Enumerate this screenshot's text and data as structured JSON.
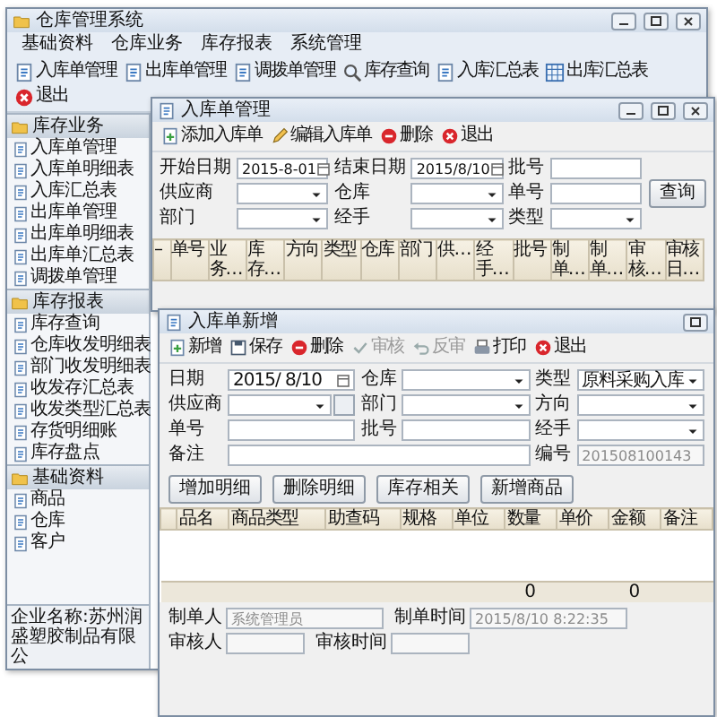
{
  "main_window": {
    "title": "仓库管理系统",
    "menu": [
      "基础资料",
      "仓库业务",
      "库存报表",
      "系统管理"
    ],
    "toolbar": [
      {
        "label": "入库单管理",
        "kind": "document"
      },
      {
        "label": "出库单管理",
        "kind": "document"
      },
      {
        "label": "调拨单管理",
        "kind": "document"
      },
      {
        "label": "库存查询",
        "kind": "search"
      },
      {
        "label": "入库汇总表",
        "kind": "document"
      },
      {
        "label": "出库汇总表",
        "kind": "table"
      },
      {
        "label": "退出",
        "kind": "exit"
      }
    ],
    "sidebar": [
      {
        "title": "库存业务",
        "items": [
          "入库单管理",
          "入库单明细表",
          "入库汇总表",
          "出库单管理",
          "出库单明细表",
          "出库单汇总表",
          "调拨单管理"
        ]
      },
      {
        "title": "库存报表",
        "items": [
          "库存查询",
          "仓库收发明细表",
          "部门收发明细表",
          "收发存汇总表",
          "收发类型汇总表",
          "存货明细账",
          "库存盘点"
        ]
      },
      {
        "title": "基础资料",
        "items": [
          "商品",
          "仓库",
          "客户"
        ]
      }
    ],
    "status_bar": "企业名称:苏州润盛塑胶制品有限公"
  },
  "query_window": {
    "title": "入库单管理",
    "toolbar": [
      {
        "label": "添加入库单",
        "kind": "add"
      },
      {
        "label": "编辑入库单",
        "kind": "edit"
      },
      {
        "label": "删除",
        "kind": "delete"
      },
      {
        "label": "退出",
        "kind": "exit"
      }
    ],
    "fields": [
      {
        "label": "开始日期",
        "kind": "date",
        "value": "2015-8-01"
      },
      {
        "label": "结束日期",
        "kind": "date",
        "value": "2015/8/10"
      },
      {
        "label": "批号",
        "kind": "text"
      },
      {
        "label": "供应商",
        "kind": "select"
      },
      {
        "label": "仓库",
        "kind": "select"
      },
      {
        "label": "单号",
        "kind": "text"
      },
      {
        "label": "部门",
        "kind": "select"
      },
      {
        "label": "经手",
        "kind": "select"
      },
      {
        "label": "类型",
        "kind": "select"
      }
    ],
    "search_button": "查询",
    "columns": [
      "–",
      "单号",
      "业务…",
      "库存…",
      "方向",
      "类型",
      "仓库",
      "部门",
      "供…",
      "经手…",
      "批号",
      "制单…",
      "制单…",
      "审核…",
      "审核日…"
    ]
  },
  "entry_window": {
    "title": "入库单新增",
    "toolbar": [
      {
        "label": "新增",
        "kind": "add",
        "disabled": false
      },
      {
        "label": "保存",
        "kind": "save",
        "disabled": false
      },
      {
        "label": "删除",
        "kind": "delete",
        "disabled": false
      },
      {
        "label": "审核",
        "kind": "check",
        "disabled": true
      },
      {
        "label": "反审",
        "kind": "undo",
        "disabled": true
      },
      {
        "label": "打印",
        "kind": "print",
        "disabled": false
      },
      {
        "label": "退出",
        "kind": "exit",
        "disabled": false
      }
    ],
    "fields": [
      {
        "label": "日期",
        "kind": "date",
        "value": "2015/ 8/10"
      },
      {
        "label": "仓库",
        "kind": "select"
      },
      {
        "label": "类型",
        "kind": "select",
        "value": "原料采购入库"
      },
      {
        "label": "供应商",
        "kind": "browse"
      },
      {
        "label": "部门",
        "kind": "select"
      },
      {
        "label": "方向",
        "kind": "select"
      },
      {
        "label": "单号",
        "kind": "text"
      },
      {
        "label": "批号",
        "kind": "text"
      },
      {
        "label": "经手",
        "kind": "select"
      },
      {
        "label": "备注",
        "kind": "wide"
      },
      {
        "label": "编号",
        "kind": "readonly",
        "value": "201508100143"
      }
    ],
    "buttons": [
      "增加明细",
      "删除明细",
      "库存相关",
      "新增商品"
    ],
    "columns": [
      {
        "label": "品名"
      },
      {
        "label": "商品类型"
      },
      {
        "label": "助查码"
      },
      {
        "label": "规格"
      },
      {
        "label": "单位"
      },
      {
        "label": "数量",
        "total": "0"
      },
      {
        "label": "单价"
      },
      {
        "label": "金额",
        "total": "0"
      },
      {
        "label": "备注"
      }
    ],
    "footer": [
      {
        "label": "制单人",
        "value": "系统管理员"
      },
      {
        "label": "制单时间",
        "value": "2015/8/10 8:22:35"
      },
      {
        "label": "审核人"
      },
      {
        "label": "审核时间"
      }
    ]
  }
}
